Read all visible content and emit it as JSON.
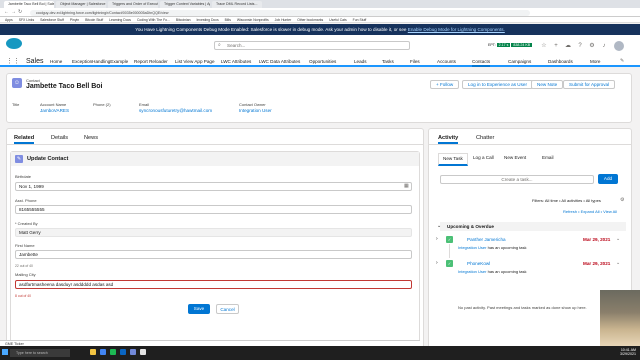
{
  "browser": {
    "tabs": [
      {
        "label": "Jambette Taco Bell Boi | Salesfor..."
      },
      {
        "label": "Object Manager | Salesforce"
      },
      {
        "label": "Triggers and Order of Execution | Ape..."
      },
      {
        "label": "Trigger Context Variables | Apex Dev..."
      },
      {
        "label": "Trace DML Record Lists..."
      }
    ],
    "url": "coolguy-dev-ed.lightning.force.com/lightning/r/Contact/0035e000005aDtnQQE/view",
    "bookmarks": [
      "Apps",
      "SFX Links",
      "Salesforce Stuff",
      "Pinyin",
      "Bitcoin Stuff",
      "Learning Docs",
      "Coding With The Fo...",
      "Bitcoinian",
      "Investing Docs",
      "Bills",
      "Wisconsin Nonprofits",
      "Job Hunter",
      "Other bookmarks",
      "Useful Cats",
      "Fun Stuff"
    ]
  },
  "banner": {
    "text": "You Have Lightning Components Debug Mode Enabled: Salesforce is slower in debug mode. Ask your admin how to disable it, or see",
    "link": "Enable Debug Mode for Lightning Components."
  },
  "header": {
    "search_placeholder": "Search...",
    "setup_badges": [
      "EPT:",
      "2.17 s",
      "838.24 KB"
    ]
  },
  "nav": {
    "app_name": "Sales",
    "items": [
      "Home",
      "ExceptionHandlingExample",
      "Report Reloader",
      "List View App Page",
      "LWC Attributes",
      "LWC Data Attributes",
      "Opportunities",
      "Leads",
      "Tasks",
      "Files",
      "Accounts",
      "Contacts",
      "Campaigns",
      "Dashboards",
      "More"
    ]
  },
  "record": {
    "type": "Contact",
    "name": "Jambette Taco Bell Boi",
    "actions": [
      "+ Follow",
      "Log in to Experience as User",
      "New Note",
      "Submit for Approval"
    ],
    "fields": {
      "title_label": "Title",
      "account_label": "Account Name",
      "account_value": "JamboVARES",
      "phone_label": "Phone (2)",
      "email_label": "Email",
      "email_value": "syncronousfuturetry@hawtmail.com",
      "owner_label": "Contact Owner",
      "owner_value": "Integration User"
    }
  },
  "left_tabs": [
    "Related",
    "Details",
    "News"
  ],
  "form": {
    "title": "Update Contact",
    "birthdate_label": "Birthdate",
    "birthdate_value": "Nov 1, 1999",
    "phone_label": "Asst. Phone",
    "phone_value": "8165555555",
    "created_label": "* Created By",
    "created_value": "Matt Gerry",
    "firstname_label": "First Name",
    "firstname_value": "Jambette",
    "counter_1": "22 out of 40",
    "mailing_label": "Mailing City",
    "mailing_value": "asdfartmasheena dasduyr asddddd asdas asd",
    "error_text": "8 out of 40",
    "save": "Save",
    "cancel": "Cancel"
  },
  "activity": {
    "tabs": [
      "Activity",
      "Chatter"
    ],
    "subtabs": [
      "New Task",
      "Log a Call",
      "New Event",
      "Email"
    ],
    "task_placeholder": "Create a task...",
    "add": "Add",
    "filters": "Filters: All time • All activities • All types",
    "links": "Refresh • Expand All • View All",
    "upcoming": "Upcoming & Overdue",
    "items": [
      {
        "name": "Panther Jamericha",
        "owner": "Integration User",
        "desc": "has an upcoming task",
        "date": "Mar 29, 2021"
      },
      {
        "name": "PhoneKowl",
        "owner": "Integration User",
        "desc": "has an upcoming task",
        "date": "Mar 29, 2021"
      }
    ],
    "no_past": "No past activity. Past meetings and tasks marked as done show up here."
  },
  "taskbar": {
    "search": "Type here to search",
    "download": "GME Ticker",
    "time": "10:41 AM",
    "date": "3/29/2021"
  }
}
